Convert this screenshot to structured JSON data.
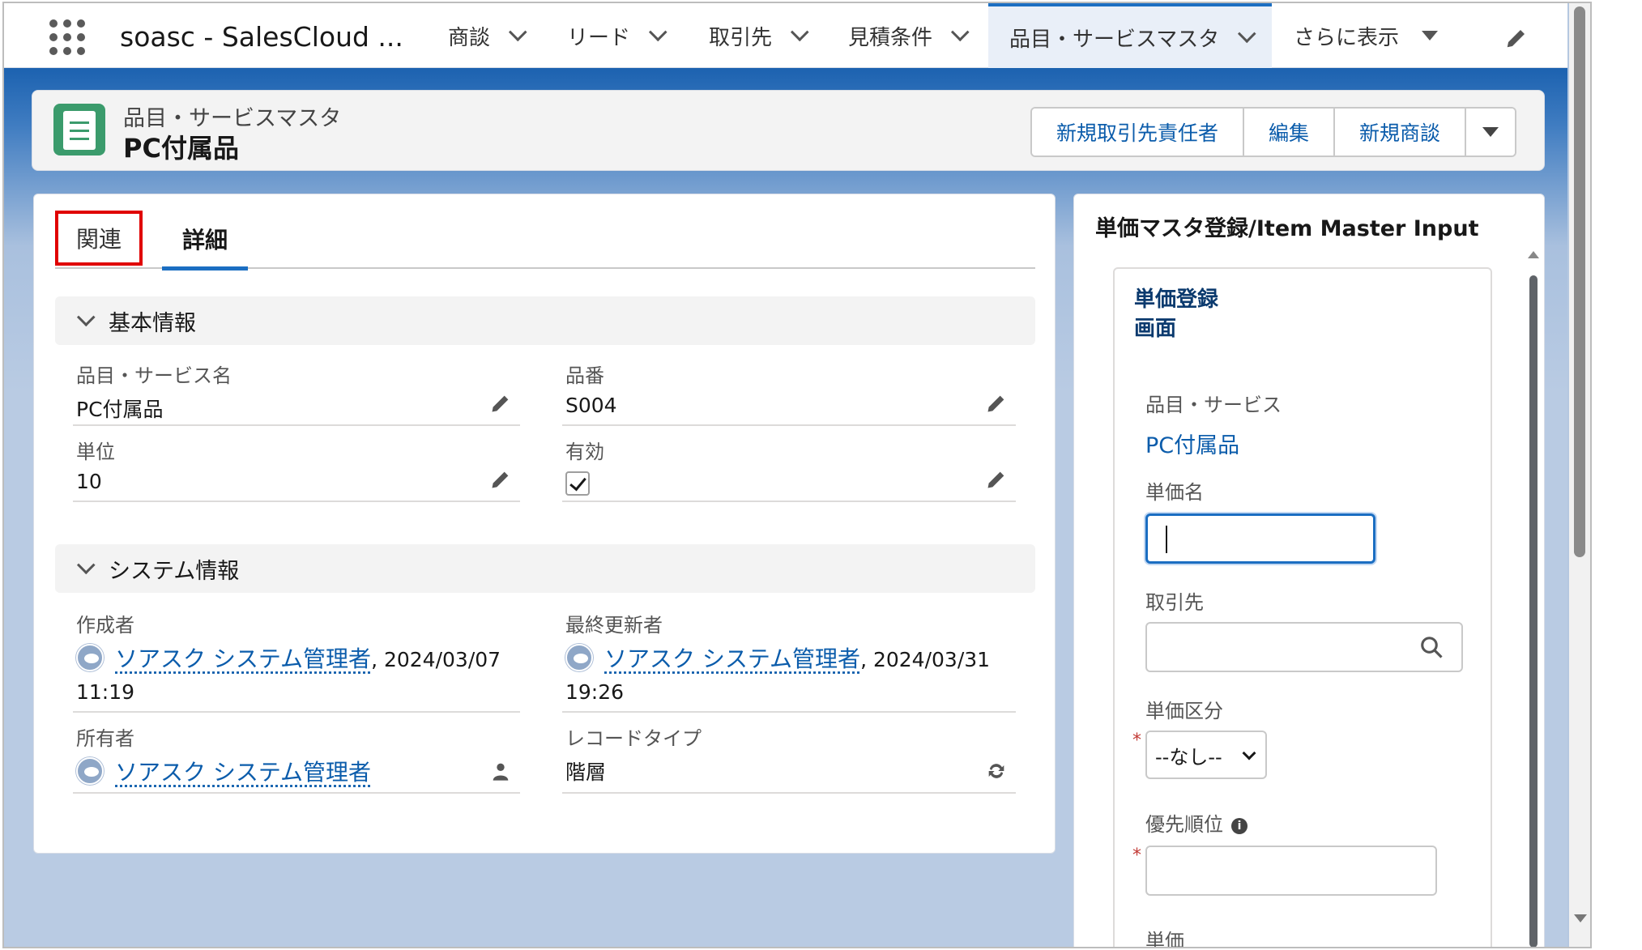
{
  "app": {
    "name": "soasc - SalesCloud ...",
    "nav": [
      {
        "label": "商談"
      },
      {
        "label": "リード"
      },
      {
        "label": "取引先"
      },
      {
        "label": "見積条件"
      },
      {
        "label": "品目・サービスマスタ",
        "active": true
      },
      {
        "label": "さらに表示"
      }
    ]
  },
  "record": {
    "object_label": "品目・サービスマスタ",
    "title": "PC付属品",
    "actions": [
      "新規取引先責任者",
      "編集",
      "新規商談"
    ]
  },
  "tabs": {
    "related": "関連",
    "detail": "詳細"
  },
  "sections": {
    "basic": {
      "title": "基本情報",
      "fields": {
        "name_label": "品目・サービス名",
        "name_value": "PC付属品",
        "code_label": "品番",
        "code_value": "S004",
        "unit_label": "単位",
        "unit_value": "10",
        "active_label": "有効",
        "active_checked": true
      }
    },
    "system": {
      "title": "システム情報",
      "created_label": "作成者",
      "created_user": "ソアスク システム管理者",
      "created_date": ", 2024/03/07",
      "created_time": "11:19",
      "modified_label": "最終更新者",
      "modified_user": "ソアスク システム管理者",
      "modified_date": ", 2024/03/31",
      "modified_time": "19:26",
      "owner_label": "所有者",
      "owner_user": "ソアスク システム管理者",
      "record_type_label": "レコードタイプ",
      "record_type_value": "階層"
    }
  },
  "side_panel": {
    "title": "単価マスタ登録/Item Master Input",
    "heading_line1": "単価登録",
    "heading_line2": "画面",
    "item_label": "品目・サービス",
    "item_value": "PC付属品",
    "price_name_label": "単価名",
    "price_name_value": "",
    "account_label": "取引先",
    "account_value": "",
    "price_type_label": "単価区分",
    "price_type_value": "--なし--",
    "priority_label": "優先順位",
    "priority_value": "",
    "unit_price_label": "単価",
    "required_mark": "*"
  },
  "colors": {
    "accent": "#1b6ec2",
    "link": "#0b5cab",
    "highlight_box": "#e00000",
    "object_icon": "#3b9b6c"
  }
}
